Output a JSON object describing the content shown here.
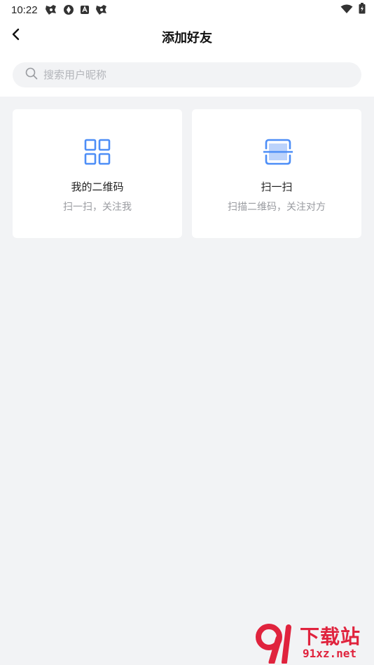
{
  "status_bar": {
    "time": "10:22",
    "icons": [
      "game-icon",
      "app-icon",
      "android-icon",
      "game-icon"
    ],
    "right_icons": [
      "wifi-icon",
      "battery-icon"
    ]
  },
  "header": {
    "title": "添加好友",
    "back_icon": "chevron-left-icon"
  },
  "search": {
    "placeholder": "搜索用户昵称",
    "value": "",
    "icon": "search-icon"
  },
  "cards": [
    {
      "icon": "qr-code-icon",
      "title": "我的二维码",
      "subtitle": "扫一扫，关注我"
    },
    {
      "icon": "scan-icon",
      "title": "扫一扫",
      "subtitle": "扫描二维码，关注对方"
    }
  ],
  "watermark": {
    "text": "下载站",
    "url": "91xz.net"
  },
  "colors": {
    "accent": "#4d8ef7",
    "background": "#f2f3f5",
    "card": "#ffffff",
    "watermark": "#e0233d"
  }
}
